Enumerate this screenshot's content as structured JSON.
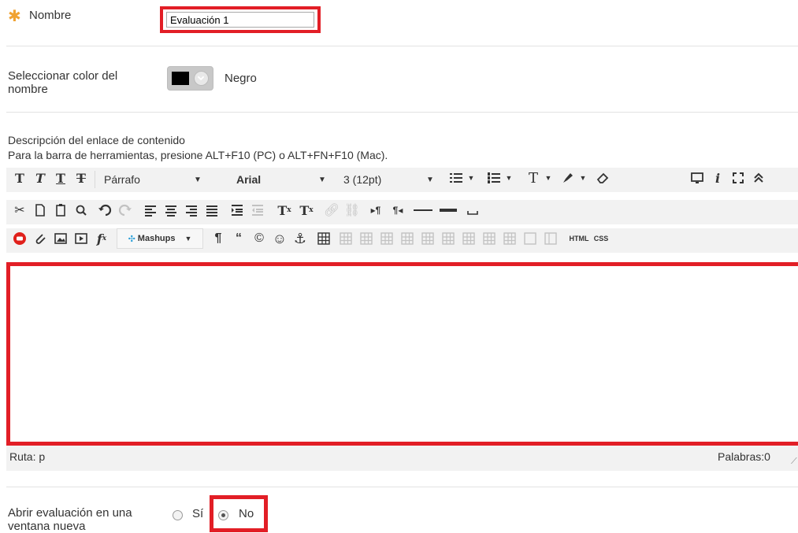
{
  "name_field": {
    "required_mark": "✱",
    "label": "Nombre",
    "value": "Evaluación 1"
  },
  "color_field": {
    "label": "Seleccionar color del nombre",
    "selected_color_name": "Negro",
    "selected_color": "#000000"
  },
  "description": {
    "label": "Descripción del enlace de contenido",
    "toolbar_hint": "Para la barra de herramientas, presione ALT+F10 (PC) o ALT+FN+F10 (Mac).",
    "format_select": "Párrafo",
    "font_select": "Arial",
    "size_select": "3 (12pt)",
    "mashups_label": "Mashups",
    "html_label": "HTML",
    "css_label": "CSS",
    "path_label": "Ruta: p",
    "words_label": "Palabras:0"
  },
  "open_new_window": {
    "label": "Abrir evaluación en una ventana nueva",
    "yes_label": "Sí",
    "no_label": "No",
    "selected": "No"
  },
  "colors": {
    "required": "#f0a232",
    "highlight": "#e21e26",
    "toolbar_bg": "#f2f2f2"
  }
}
